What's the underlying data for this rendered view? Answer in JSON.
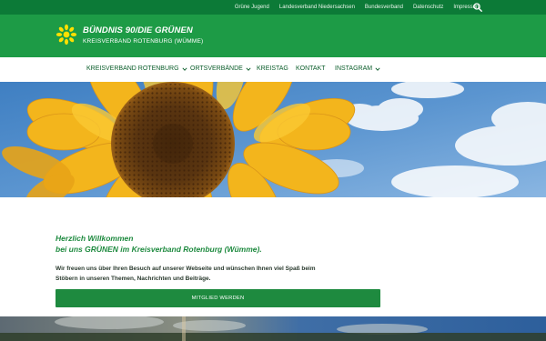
{
  "topbar": {
    "links": [
      "Grüne Jugend",
      "Landesverband Niedersachsen",
      "Bundesverband",
      "Datenschutz",
      "Impressum"
    ],
    "search_icon": "search-icon"
  },
  "header": {
    "title": "BÜNDNIS 90/DIE GRÜNEN",
    "subtitle": "KREISVERBAND ROTENBURG (WÜMME)",
    "logo_icon": "sunflower-logo"
  },
  "nav": {
    "items": [
      {
        "label": "KREISVERBAND ROTENBURG",
        "dropdown": true
      },
      {
        "label": "ORTSVERBÄNDE",
        "dropdown": true
      },
      {
        "label": "KREISTAG",
        "dropdown": false
      },
      {
        "label": "KONTAKT",
        "dropdown": false
      },
      {
        "label": "INSTAGRAM",
        "dropdown": true
      }
    ]
  },
  "welcome": {
    "title_line1": "Herzlich Willkommen",
    "title_line2": "bei uns GRÜNEN im Kreisverband Rotenburg (Wümme).",
    "text": "Wir freuen uns über Ihren Besuch auf unserer Webseite und wünschen Ihnen viel Spaß beim Stöbern in unseren Themen, Nachrichten und Beiträge.",
    "button_label": "MITGLIED WERDEN"
  },
  "colors": {
    "topbar": "#0c7a37",
    "header": "#1d9b46",
    "nav_text": "#0a5d2a",
    "accent": "#1e8a3f"
  }
}
